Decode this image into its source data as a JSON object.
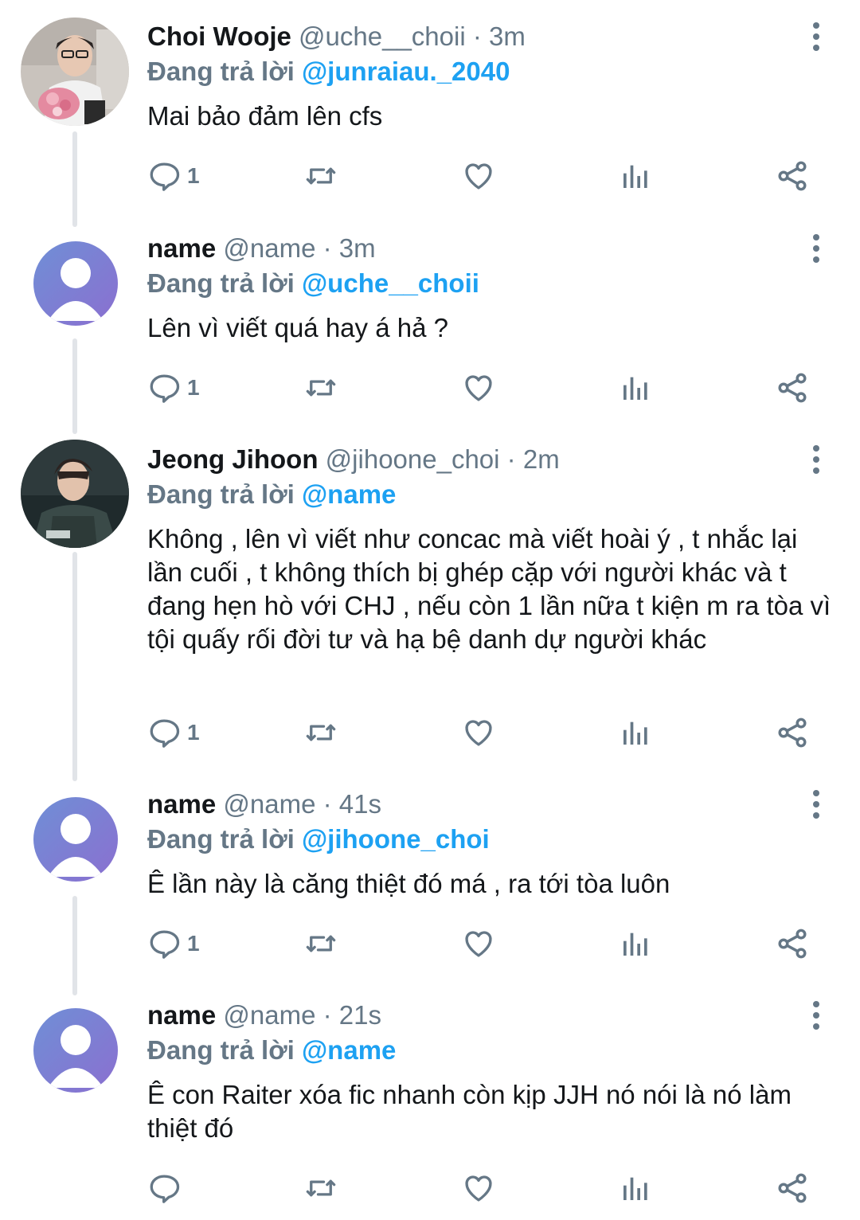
{
  "tweets": [
    {
      "display_name": "Choi Wooje",
      "handle": "@uche__choii",
      "separator": "·",
      "time": "3m",
      "reply_prefix": "Đang trả lời",
      "reply_to": "@junraiau._2040",
      "text": "Mai bảo đảm lên cfs",
      "reply_count": "1",
      "avatar": "photo-avatar"
    },
    {
      "display_name": "name",
      "handle": "@name",
      "separator": "·",
      "time": "3m",
      "reply_prefix": "Đang trả lời",
      "reply_to": "@uche__choii",
      "text": "Lên vì viết quá hay á hả ?",
      "reply_count": "1",
      "avatar": "default-avatar"
    },
    {
      "display_name": "Jeong Jihoon",
      "handle": "@jihoone_choi",
      "separator": "·",
      "time": "2m",
      "reply_prefix": "Đang trả lời",
      "reply_to": "@name",
      "text": "Không , lên vì viết như concac mà viết hoài ý , t nhắc lại lần cuối , t không thích bị ghép cặp với người khác và t đang hẹn hò với CHJ , nếu còn 1 lần nữa t kiện m ra tòa vì tội quấy rối đời tư  và hạ bệ danh dự người khác",
      "reply_count": "1",
      "avatar": "photo-avatar"
    },
    {
      "display_name": "name",
      "handle": "@name",
      "separator": "·",
      "time": "41s",
      "reply_prefix": "Đang trả lời",
      "reply_to": "@jihoone_choi",
      "text": "Ê lần này là căng thiệt đó má , ra tới tòa luôn",
      "reply_count": "1",
      "avatar": "default-avatar"
    },
    {
      "display_name": "name",
      "handle": "@name",
      "separator": "·",
      "time": "21s",
      "reply_prefix": "Đang trả lời",
      "reply_to": "@name",
      "text": "Ê con Raiter xóa fic nhanh còn kịp JJH nó nói là nó làm thiệt đó",
      "reply_count": "",
      "avatar": "default-avatar"
    }
  ],
  "icons": {
    "reply": "reply-bubble-icon",
    "retweet": "retweet-icon",
    "like": "heart-icon",
    "analytics": "analytics-icon",
    "share": "share-icon",
    "more": "more-vertical-icon"
  },
  "colors": {
    "text": "#14171a",
    "muted": "#657786",
    "link": "#1da1f2",
    "thread_line": "#e1e4e8",
    "default_avatar_bg": "#6f8fd6"
  }
}
